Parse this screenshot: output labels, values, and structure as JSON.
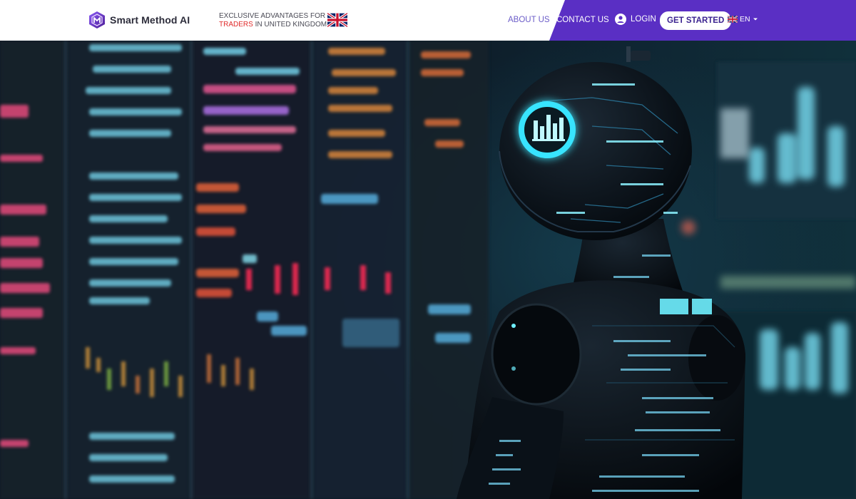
{
  "brand": {
    "name": "Smart Method AI",
    "color": "#5a2fc4"
  },
  "tagline": {
    "line1": "EXCLUSIVE ADVANTAGES FOR",
    "accent": "TRADERS",
    "line2_rest": " IN UNITED KINGDOM",
    "accent_color": "#e02b2b"
  },
  "nav": {
    "about": "ABOUT US",
    "contact": "CONTACT US",
    "login": "LOGIN",
    "cta": "GET STARTED",
    "language": "EN"
  },
  "icons": {
    "logo": "hexagon-logo-icon",
    "flag": "uk-flag-icon",
    "user": "user-icon",
    "caret": "chevron-down-icon"
  },
  "hero": {
    "image": "ai-robot-trading-screens-illustration"
  }
}
